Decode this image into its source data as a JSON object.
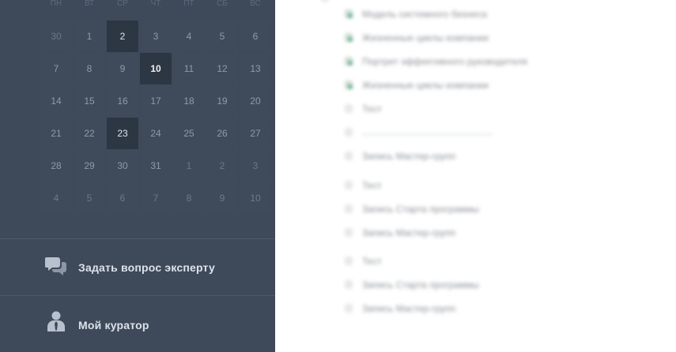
{
  "calendar": {
    "weekdays": [
      "ПН",
      "ВТ",
      "СР",
      "ЧТ",
      "ПТ",
      "СБ",
      "ВС"
    ],
    "weeks": [
      [
        "30",
        "1",
        "2",
        "3",
        "4",
        "5",
        "6"
      ],
      [
        "7",
        "8",
        "9",
        "10",
        "11",
        "12",
        "13"
      ],
      [
        "14",
        "15",
        "16",
        "17",
        "18",
        "19",
        "20"
      ],
      [
        "21",
        "22",
        "23",
        "24",
        "25",
        "26",
        "27"
      ],
      [
        "28",
        "29",
        "30",
        "31",
        "1",
        "2",
        "3"
      ],
      [
        "4",
        "5",
        "6",
        "7",
        "8",
        "9",
        "10"
      ]
    ],
    "highlighted_days": [
      "2",
      "10",
      "23"
    ]
  },
  "menu": {
    "ask_expert": "Задать вопрос эксперту",
    "my_curator": "Мой куратор",
    "ask_expert_icon": "chat-bubbles-icon",
    "my_curator_icon": "person-tie-icon"
  },
  "content_list": {
    "items": [
      {
        "label": "Модель системного бизнеса",
        "status": "done"
      },
      {
        "label": "Жизненные циклы компании",
        "status": "done"
      },
      {
        "label": "Портрет эффективного руководителя",
        "status": "done"
      },
      {
        "label": "Жизненные циклы компании",
        "status": "done"
      },
      {
        "label": "Тест",
        "status": "todo"
      },
      {
        "label": "",
        "status": "todo"
      },
      {
        "label": "Запись Мастер-групп",
        "status": "todo"
      },
      {
        "label": "Тест",
        "status": "todo"
      },
      {
        "label": "Запись Старта программы",
        "status": "todo"
      },
      {
        "label": "Запись Мастер-групп",
        "status": "todo"
      },
      {
        "label": "Тест",
        "status": "todo"
      },
      {
        "label": "Запись Старта программы",
        "status": "todo"
      },
      {
        "label": "Запись Мастер-групп",
        "status": "todo"
      }
    ]
  },
  "colors": {
    "sidebar_bg": "#3e4959",
    "highlight_cell": "#2d3744",
    "done_marker": "#4caf7d"
  }
}
